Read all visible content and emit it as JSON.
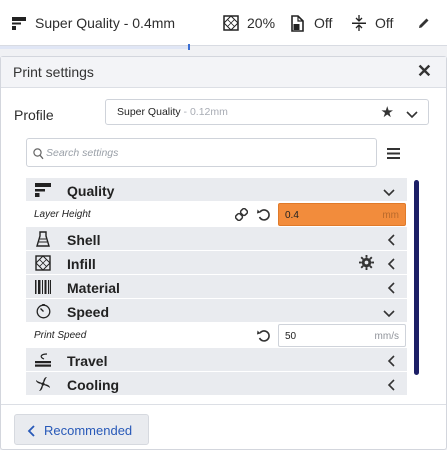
{
  "topbar": {
    "profile_label": "Super Quality - 0.4mm",
    "infill_value": "20%",
    "support_value": "Off",
    "adhesion_value": "Off"
  },
  "panel": {
    "title": "Print settings",
    "close_glyph": "✕",
    "profile": {
      "label": "Profile",
      "name": "Super Quality",
      "sub": " - 0.12mm"
    },
    "search_placeholder": "Search settings",
    "categories": [
      {
        "label": "Quality",
        "icon": "quality-icon",
        "expanded": true
      },
      {
        "label": "Shell",
        "icon": "shell-icon",
        "expanded": false
      },
      {
        "label": "Infill",
        "icon": "infill-icon",
        "expanded": false
      },
      {
        "label": "Material",
        "icon": "material-icon",
        "expanded": false
      },
      {
        "label": "Speed",
        "icon": "speed-icon",
        "expanded": true
      },
      {
        "label": "Travel",
        "icon": "travel-icon",
        "expanded": false
      },
      {
        "label": "Cooling",
        "icon": "cooling-icon",
        "expanded": false
      }
    ],
    "settings": {
      "layer_height": {
        "label": "Layer Height",
        "value": "0.4",
        "unit": "mm"
      },
      "print_speed": {
        "label": "Print Speed",
        "value": "50",
        "unit": "mm/s"
      }
    },
    "recommended_label": "Recommended"
  },
  "colors": {
    "warning_field": "#f28c3c",
    "accent_blue": "#2859b8",
    "scrollbar": "#1c1f66"
  }
}
